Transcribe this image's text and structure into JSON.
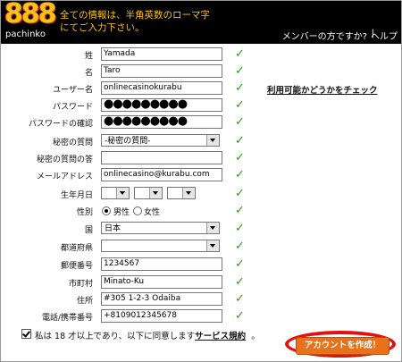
{
  "header": {
    "logo_number": "888",
    "logo_sub": "pachinko",
    "message_line1": "全ての情報は、半角英数のローマ字",
    "message_line2": "にてご入力下さい。",
    "member_link": "メンバーの方ですか?",
    "separator": "|",
    "help_link": "ヘルプ"
  },
  "form": {
    "last_name": {
      "label": "姓",
      "value": "Yamada"
    },
    "first_name": {
      "label": "名",
      "value": "Taro"
    },
    "username": {
      "label": "ユーザー名",
      "value": "onlinecasinokurabu"
    },
    "availability_link": "利用可能かどうかをチェック",
    "password": {
      "label": "パスワード",
      "value": "●●●●●●●●●"
    },
    "password_confirm": {
      "label": "パスワードの確認",
      "value": "●●●●●●●●●"
    },
    "secret_question": {
      "label": "秘密の質問",
      "value": "-秘密の質問-"
    },
    "secret_answer": {
      "label": "秘密の質問の答",
      "value": ""
    },
    "email": {
      "label": "メールアドレス",
      "value": "onlinecasino@kurabu.com"
    },
    "birthdate": {
      "label": "生年月日"
    },
    "gender": {
      "label": "性別",
      "male": "男性",
      "female": "女性",
      "selected": "male"
    },
    "country": {
      "label": "国",
      "value": "日本"
    },
    "prefecture": {
      "label": "都道府県",
      "value": ""
    },
    "postal_code": {
      "label": "郵便番号",
      "value": "1234567"
    },
    "city": {
      "label": "市町村",
      "value": "Minato-Ku"
    },
    "address": {
      "label": "住所",
      "value": "#305 1-2-3 Odaiba"
    },
    "phone": {
      "label": "電話/携帯番号",
      "value": "+8109012345678"
    }
  },
  "footer": {
    "agree_text": "私は 18 才以上であり、以下に同意します",
    "terms_link": "サービス規約",
    "period": "。",
    "create_button": "アカウントを作成！"
  },
  "colors": {
    "header_bg": "#000000",
    "header_text": "#ffc400",
    "check": "#2f9a1b",
    "button": "#e8711c",
    "highlight_ring": "#e4100c"
  }
}
